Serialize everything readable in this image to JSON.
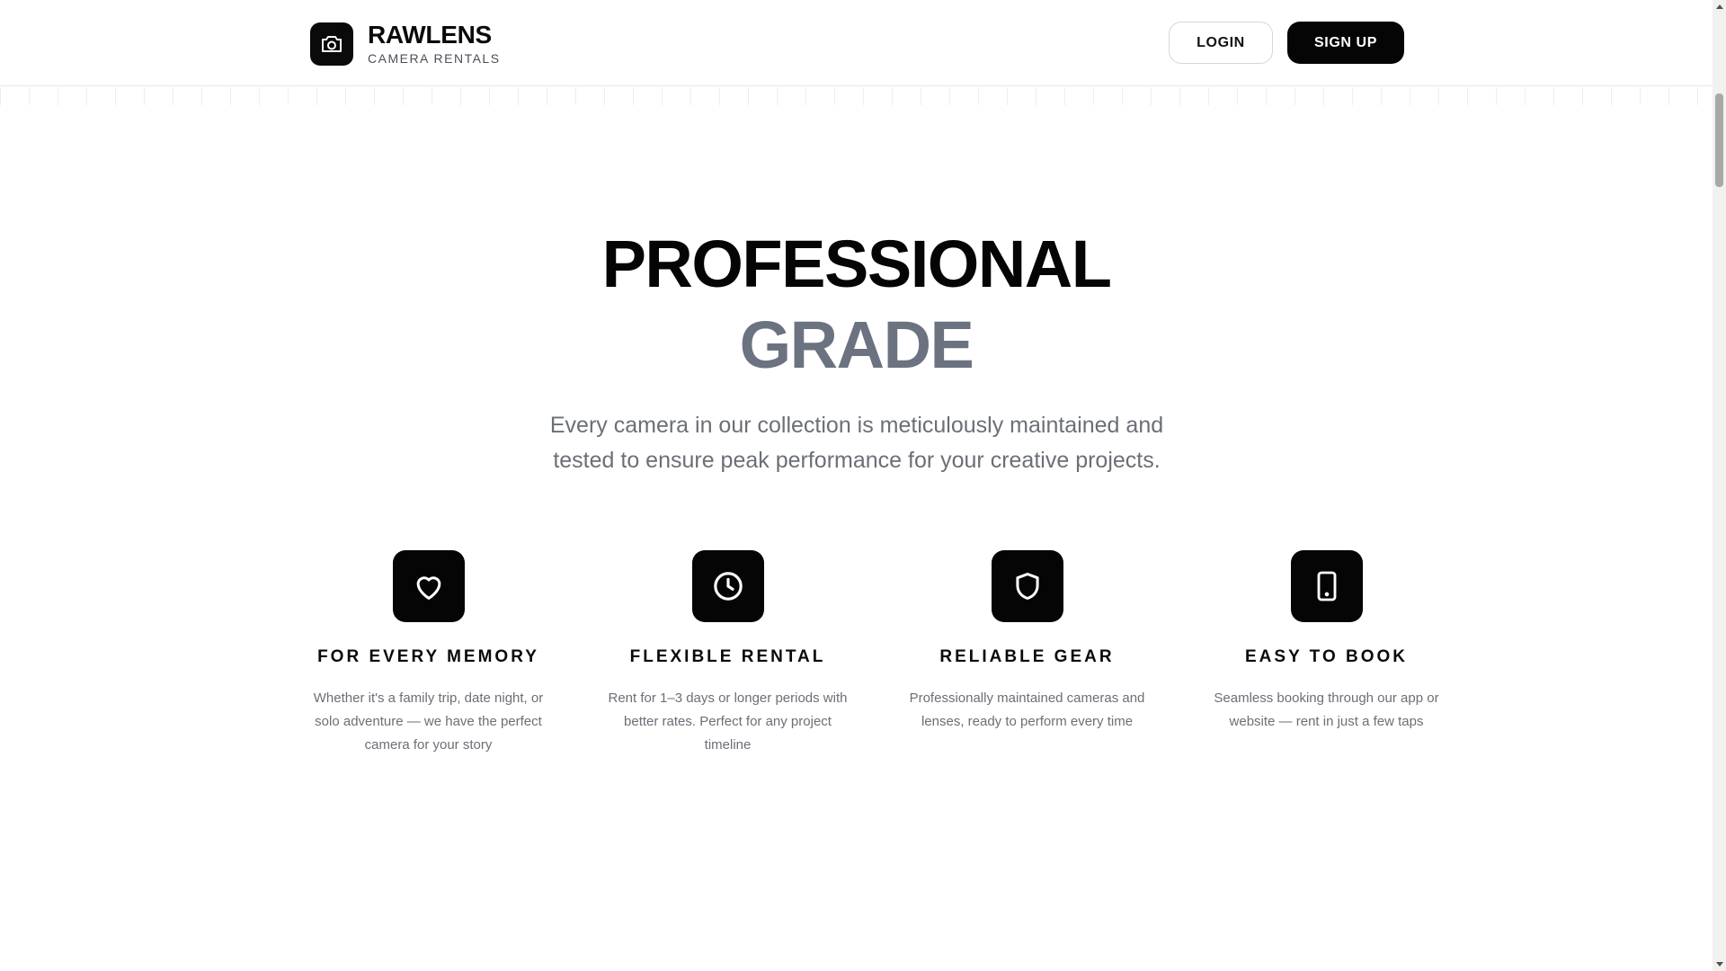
{
  "brand": {
    "name": "RAWLENS",
    "subtitle": "CAMERA RENTALS",
    "logo_icon": "camera-icon"
  },
  "nav": {
    "login_label": "LOGIN",
    "signup_label": "SIGN UP"
  },
  "hero": {
    "title_line1": "PROFESSIONAL",
    "title_line2": "GRADE",
    "description": "Every camera in our collection is meticulously maintained and tested to ensure peak performance for your creative projects."
  },
  "features": [
    {
      "icon": "heart-icon",
      "title": "FOR EVERY MEMORY",
      "text": "Whether it's a family trip, date night, or solo adventure — we have the perfect camera for your story"
    },
    {
      "icon": "clock-icon",
      "title": "FLEXIBLE RENTAL",
      "text": "Rent for 1–3 days or longer periods with better rates. Perfect for any project timeline"
    },
    {
      "icon": "shield-icon",
      "title": "RELIABLE GEAR",
      "text": "Professionally maintained cameras and lenses, ready to perform every time"
    },
    {
      "icon": "tablet-icon",
      "title": "EASY TO BOOK",
      "text": "Seamless booking through our app or website — rent in just a few taps"
    }
  ],
  "colors": {
    "primary": "#050505",
    "accent_gray": "#6b7280",
    "text_muted": "#6b6f76"
  }
}
